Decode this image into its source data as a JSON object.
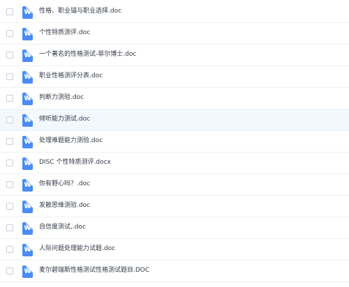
{
  "files": [
    {
      "name": "性格、职业锚与职业选择.doc",
      "icon": "word-doc-icon",
      "icon_letter": "W"
    },
    {
      "name": "个性特质测评.doc",
      "icon": "word-doc-icon",
      "icon_letter": "W"
    },
    {
      "name": "一个著名的性格测试-菲尔博士.doc",
      "icon": "word-doc-icon",
      "icon_letter": "W"
    },
    {
      "name": "职业性格测评分表.doc",
      "icon": "word-doc-icon",
      "icon_letter": "W"
    },
    {
      "name": "判断力测验.doc",
      "icon": "word-doc-icon",
      "icon_letter": "W"
    },
    {
      "name": "倾听能力测试.doc",
      "icon": "word-doc-icon",
      "icon_letter": "W"
    },
    {
      "name": "处理难题能力测验.doc",
      "icon": "word-doc-icon",
      "icon_letter": "W"
    },
    {
      "name": "DISC 个性特质测评.docx",
      "icon": "word-doc-icon",
      "icon_letter": "W"
    },
    {
      "name": "你有野心吗？.doc",
      "icon": "word-doc-icon",
      "icon_letter": "W"
    },
    {
      "name": "发散思维测验.doc",
      "icon": "word-doc-icon",
      "icon_letter": "W"
    },
    {
      "name": "自信度测试,.doc",
      "icon": "word-doc-icon",
      "icon_letter": "W"
    },
    {
      "name": "人际问题处理能力试题.doc",
      "icon": "word-doc-icon",
      "icon_letter": "W"
    },
    {
      "name": "麦尔碧瑞斯性格测试性格测试题目.DOC",
      "icon": "word-doc-icon",
      "icon_letter": "W"
    }
  ],
  "hovered_index": 5,
  "colors": {
    "icon_blue": "#4a8cf7",
    "hover_row": "#f3f8ff",
    "text": "#333a44"
  }
}
